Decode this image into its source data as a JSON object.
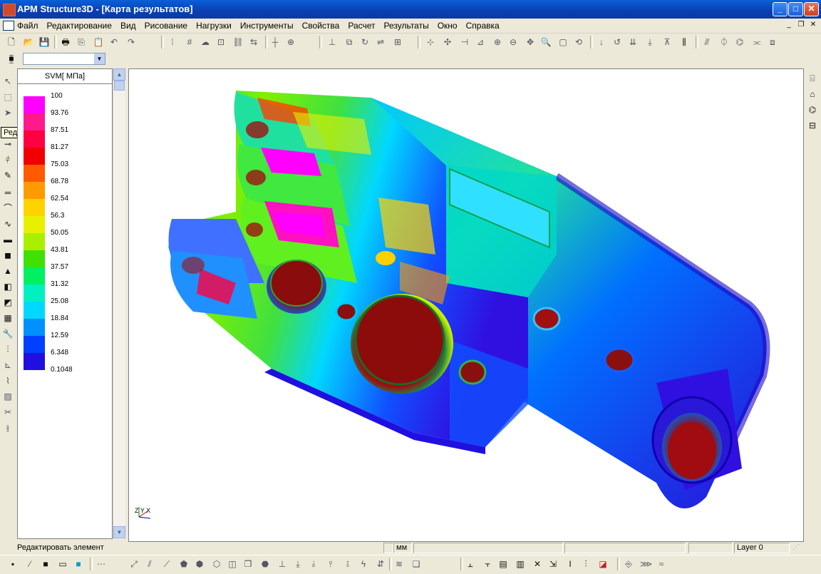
{
  "window": {
    "title": "APM Structure3D - [Карта результатов]"
  },
  "window_buttons": {
    "minimize": "_",
    "maximize": "□",
    "close": "✕"
  },
  "menu": {
    "items": [
      "Файл",
      "Редактирование",
      "Вид",
      "Рисование",
      "Нагрузки",
      "Инструменты",
      "Свойства",
      "Расчет",
      "Результаты",
      "Окно",
      "Справка"
    ]
  },
  "mdi_buttons": {
    "minimize": "_",
    "restore": "❐",
    "close": "✕"
  },
  "legend": {
    "title": "SVM[ МПа]",
    "entries": [
      {
        "value": "100",
        "color": "#ff00ff"
      },
      {
        "value": "93.76",
        "color": "#ff1a8c"
      },
      {
        "value": "87.51",
        "color": "#ff0040"
      },
      {
        "value": "81.27",
        "color": "#f00000"
      },
      {
        "value": "75.03",
        "color": "#ff5a00"
      },
      {
        "value": "68.78",
        "color": "#ff9a00"
      },
      {
        "value": "62.54",
        "color": "#ffd200"
      },
      {
        "value": "56.3",
        "color": "#e8f000"
      },
      {
        "value": "50.05",
        "color": "#a8f000"
      },
      {
        "value": "43.81",
        "color": "#40e000"
      },
      {
        "value": "37.57",
        "color": "#00f060"
      },
      {
        "value": "31.32",
        "color": "#00f0c0"
      },
      {
        "value": "25.08",
        "color": "#00d8ff"
      },
      {
        "value": "18.84",
        "color": "#0090ff"
      },
      {
        "value": "12.59",
        "color": "#0040ff"
      },
      {
        "value": "6.348",
        "color": "#2010e0"
      },
      {
        "value": "0.1048",
        "color": "#5000d0"
      }
    ]
  },
  "tooltip": {
    "text": "Редактировать"
  },
  "viewport": {
    "axes_label": "Z Y X"
  },
  "statusbar": {
    "message": "Редактировать элемент",
    "units": "мм",
    "layer": "Layer 0"
  },
  "icons": [
    "new-icon",
    "open-icon",
    "save-icon",
    "print-icon",
    "copy-icon",
    "paste-icon",
    "undo-icon",
    "redo-icon",
    "grid-icon",
    "zoom-in-icon",
    "zoom-out-icon",
    "pan-icon",
    "rotate-icon",
    "pointer-icon"
  ]
}
